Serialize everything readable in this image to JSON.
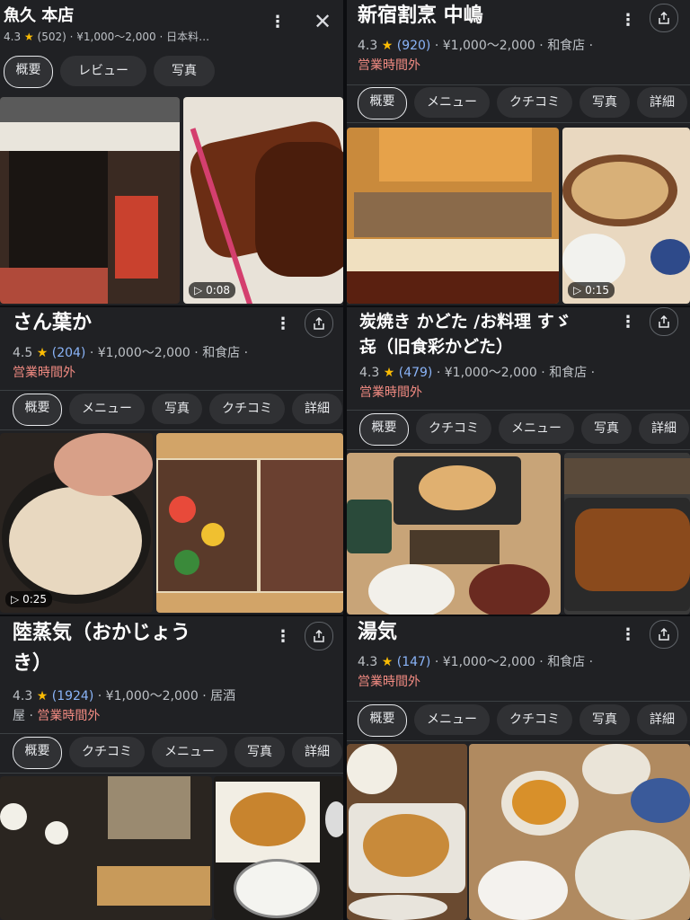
{
  "cards": [
    {
      "name": "魚久 本店",
      "rating": "4.3",
      "reviews": "(502)",
      "price": "¥1,000～2,000",
      "category": "日本料…",
      "chips": [
        "概要",
        "レビュー",
        "写真"
      ],
      "video_duration": "0:08"
    },
    {
      "name": "新宿割烹 中嶋",
      "rating": "4.3",
      "reviews": "(920)",
      "price": "¥1,000～2,000",
      "category": "和食店",
      "status": "営業時間外",
      "chips": [
        "概要",
        "メニュー",
        "クチコミ",
        "写真",
        "詳細"
      ],
      "video_duration": "0:15"
    },
    {
      "name": "さん葉か",
      "rating": "4.5",
      "reviews": "(204)",
      "price": "¥1,000～2,000",
      "category": "和食店",
      "status": "営業時間外",
      "chips": [
        "概要",
        "メニュー",
        "写真",
        "クチコミ",
        "詳細"
      ],
      "video_duration": "0:25"
    },
    {
      "name": "炭焼き かどた /お料理 すゞ\n㐂（旧食彩かどた）",
      "rating": "4.3",
      "reviews": "(479)",
      "price": "¥1,000～2,000",
      "category": "和食店",
      "status": "営業時間外",
      "chips": [
        "概要",
        "クチコミ",
        "メニュー",
        "写真",
        "詳細"
      ]
    },
    {
      "name": "陸蒸気（おかじょう\nき）",
      "rating": "4.3",
      "reviews": "(1924)",
      "price": "¥1,000～2,000",
      "category": "居酒",
      "category_cont": "屋",
      "status": "営業時間外",
      "chips": [
        "概要",
        "クチコミ",
        "メニュー",
        "写真",
        "詳細"
      ]
    },
    {
      "name": "湯気",
      "rating": "4.3",
      "reviews": "(147)",
      "price": "¥1,000～2,000",
      "category": "和食店",
      "status": "営業時間外",
      "chips": [
        "概要",
        "メニュー",
        "クチコミ",
        "写真",
        "詳細"
      ]
    }
  ],
  "glyphs": {
    "star": "★",
    "sep": "·",
    "more": "⋮",
    "close": "✕",
    "play": "▷"
  },
  "colors": {
    "card_bg": "#202124",
    "chip_bg": "#303134",
    "star": "#fbbc04",
    "link": "#8ab4f8",
    "closed": "#f28b82"
  }
}
